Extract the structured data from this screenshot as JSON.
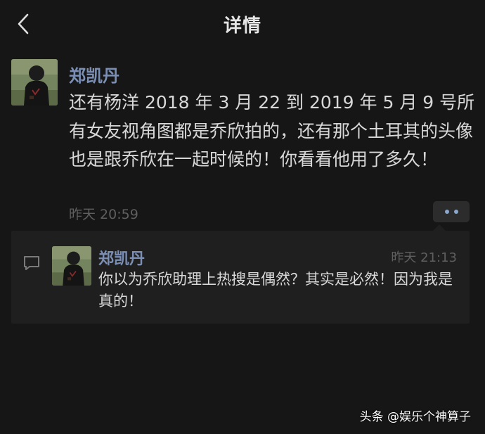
{
  "nav": {
    "title": "详情",
    "back_icon": "chevron-left-icon"
  },
  "post": {
    "author": "郑凯丹",
    "content": "还有杨洋 2018 年 3 月 22 到 2019 年 5 月 9 号所有女友视角图都是乔欣拍的，还有那个土耳其的头像也是跟乔欣在一起时候的！你看看他用了多久！",
    "time": "昨天 20:59",
    "more_icon": "more-dots-icon"
  },
  "comments": [
    {
      "author": "郑凯丹",
      "time": "昨天 21:13",
      "text": "你以为乔欣助理上热搜是偶然？其实是必然！因为我是真的！",
      "icon": "comment-icon"
    }
  ],
  "watermark": "头条 @娱乐个神算子",
  "colors": {
    "background": "#161616",
    "name": "#7b8fb4",
    "text": "#d8d8d8",
    "muted": "#5f5f5f",
    "comment_bg": "#1f1f1f"
  }
}
